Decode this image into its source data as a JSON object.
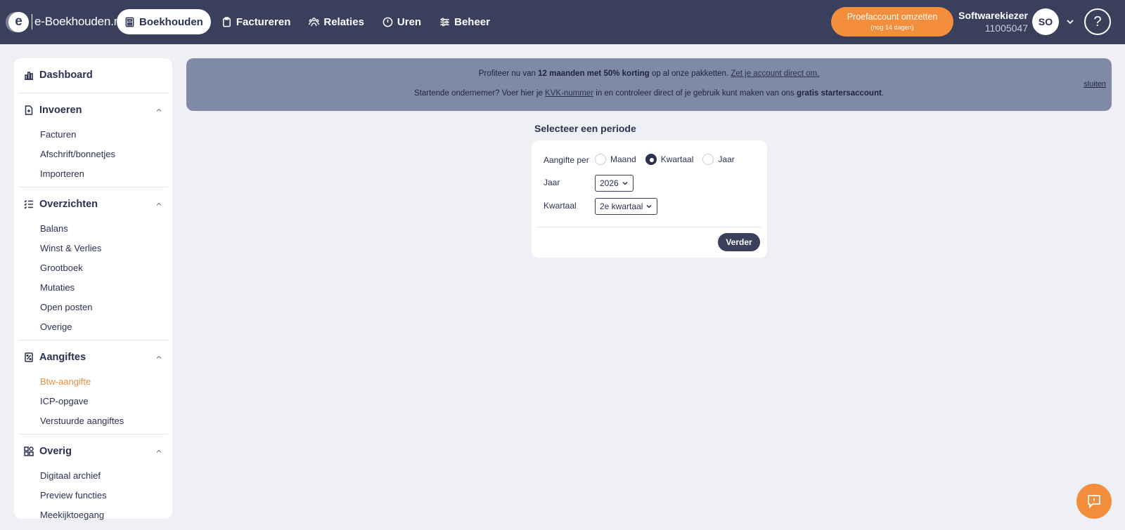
{
  "logo": {
    "mark": "e",
    "text": "e-Boekhouden.nl"
  },
  "nav": [
    {
      "label": "Boekhouden",
      "icon": "calculator-icon",
      "active": true
    },
    {
      "label": "Factureren",
      "icon": "clipboard-icon",
      "active": false
    },
    {
      "label": "Relaties",
      "icon": "people-icon",
      "active": false
    },
    {
      "label": "Uren",
      "icon": "clock-icon",
      "active": false
    },
    {
      "label": "Beheer",
      "icon": "sliders-icon",
      "active": false
    }
  ],
  "trial": {
    "label": "Proefaccount omzetten",
    "sub": "(nog 14 dagen)"
  },
  "account": {
    "name": "Softwarekiezer",
    "number": "11005047",
    "initials": "SO"
  },
  "help": "?",
  "sidebar": {
    "dashboard": "Dashboard",
    "sections": [
      {
        "title": "Invoeren",
        "items": [
          "Facturen",
          "Afschrift/bonnetjes",
          "Importeren"
        ]
      },
      {
        "title": "Overzichten",
        "items": [
          "Balans",
          "Winst & Verlies",
          "Grootboek",
          "Mutaties",
          "Open posten",
          "Overige"
        ]
      },
      {
        "title": "Aangiftes",
        "items": [
          "Btw-aangifte",
          "ICP-opgave",
          "Verstuurde aangiftes"
        ]
      },
      {
        "title": "Overig",
        "items": [
          "Digitaal archief",
          "Preview functies",
          "Meekijktoegang"
        ]
      }
    ],
    "active_item": "Btw-aangifte"
  },
  "banner": {
    "line1_pre": "Profiteer nu van ",
    "line1_bold": "12 maanden met 50% korting",
    "line1_mid": " op al onze pakketten. ",
    "line1_link": "Zet je account direct om.",
    "line2_pre": "Startende ondernemer? Voer hier je ",
    "line2_link": "KVK-nummer",
    "line2_mid": " in en controleer direct of je gebruik kunt maken van ons ",
    "line2_bold": "gratis startersaccount",
    "line2_end": ".",
    "close": "sluiten"
  },
  "period": {
    "title": "Selecteer een periode",
    "aangifte_label": "Aangifte per",
    "options": [
      "Maand",
      "Kwartaal",
      "Jaar"
    ],
    "selected": "Kwartaal",
    "jaar_label": "Jaar",
    "jaar_value": "2026",
    "kwartaal_label": "Kwartaal",
    "kwartaal_value": "2e kwartaal",
    "next": "Verder"
  },
  "colors": {
    "topbar": "#3a3f5c",
    "accent": "#f28e3c",
    "banner": "#808aa8"
  }
}
